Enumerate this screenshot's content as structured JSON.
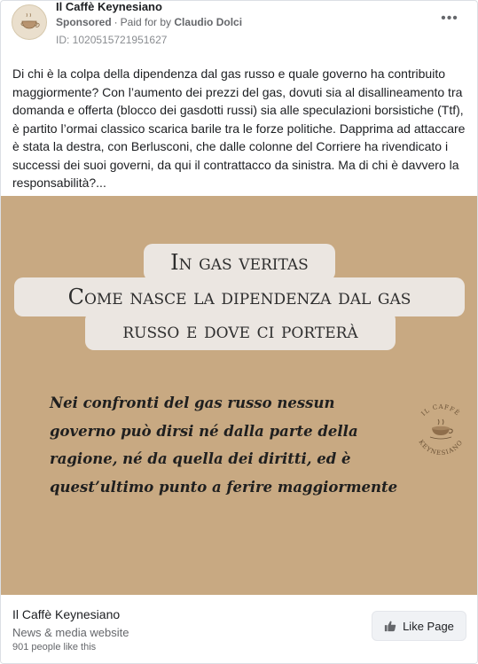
{
  "header": {
    "page_name": "Il Caffè Keynesiano",
    "sponsored_label": "Sponsored",
    "separator": "·",
    "paid_for_label": "Paid for by",
    "payer_name": "Claudio Dolci",
    "ad_id": "ID: 1020515721951627",
    "more_icon": "ellipsis-icon"
  },
  "post": {
    "body_text": "Di chi è la colpa della dipendenza dal gas russo e quale governo ha contribuito maggiormente? Con l’aumento dei prezzi del gas, dovuti sia al disallineamento tra domanda e offerta (blocco dei gasdotti russi) sia alle speculazioni borsistiche (Ttf), è partito l’ormai classico scarica barile tra le forze politiche. Dapprima ad attaccare è stata la destra, con Berlusconi, che dalle colonne del Corriere ha rivendicato i successi dei suoi governi, da qui il contrattacco da sinistra. Ma di chi è davvero la responsabilità?..."
  },
  "creative": {
    "title_line_1": "In gas veritas",
    "title_line_2": "Come nasce la dipendenza dal gas",
    "title_line_3": "russo e dove ci porterà",
    "quote": "Nei confronti del gas russo nessun governo può dirsi né dalla parte della ragione, né da quella dei diritti, ed è quest’ultimo punto a ferire maggiormente",
    "logo_text_top": "IL CAFFÈ",
    "logo_text_bottom": "KEYNESIANO",
    "background_color": "#c8a982",
    "title_box_color": "#ebe6e1"
  },
  "footer": {
    "page_name": "Il Caffè Keynesiano",
    "category": "News & media website",
    "likes": "901 people like this",
    "like_button_label": "Like Page",
    "like_icon": "thumbs-up-icon"
  }
}
